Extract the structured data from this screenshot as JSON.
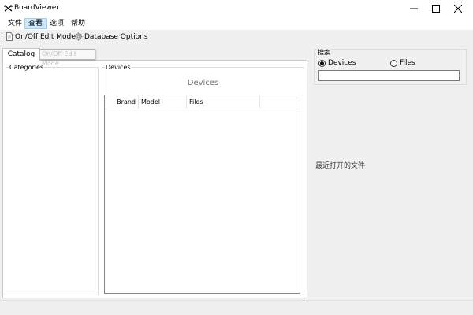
{
  "window": {
    "title": "BoardViewer",
    "app_icon": "crossed-arrows-icon",
    "controls": [
      "minimize-icon",
      "maximize-icon",
      "close-icon"
    ]
  },
  "menu": {
    "items": [
      "文件",
      "查看",
      "选项",
      "帮助"
    ],
    "active_index": 1
  },
  "toolbar": {
    "edit_mode_label": "On/Off Edit Mode",
    "edit_mode_icon": "document-icon",
    "db_options_label": "Database Options",
    "db_options_icon": "gear-icon"
  },
  "left_panel": {
    "tab_label": "Catalog",
    "tooltip": "On/Off Edit Mode",
    "categories_label": "Categories",
    "devices_label": "Devices",
    "devices_heading": "Devices",
    "columns": [
      "Brand",
      "Model",
      "Files"
    ]
  },
  "search": {
    "label": "搜索",
    "options": [
      "Devices",
      "Files"
    ],
    "selected_index": 0,
    "value": ""
  },
  "recent_files_label": "最近打开的文件",
  "colors": {
    "menu_highlight": "#cce8ff",
    "window_bg": "#f0f0f0"
  }
}
